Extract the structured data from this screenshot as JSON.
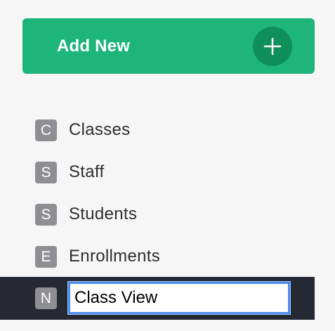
{
  "add_new": {
    "label": "Add New",
    "icon": "plus-icon",
    "colors": {
      "background": "#1db57a",
      "icon_circle": "#0f8f5a"
    }
  },
  "nav": {
    "items": [
      {
        "badge": "C",
        "label": "Classes"
      },
      {
        "badge": "S",
        "label": "Staff"
      },
      {
        "badge": "S",
        "label": "Students"
      },
      {
        "badge": "E",
        "label": "Enrollments"
      }
    ],
    "editing_item": {
      "badge": "N",
      "input_value": "Class View"
    }
  },
  "colors": {
    "sidebar_background": "#f6f6f6",
    "badge_background": "#8f8f93",
    "editing_row_background": "#262833",
    "input_focus_border": "#4a8ff0"
  }
}
